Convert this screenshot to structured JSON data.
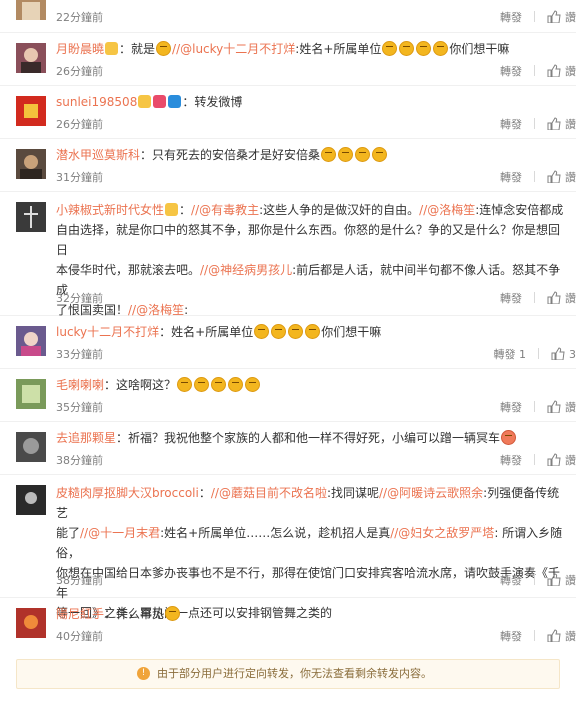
{
  "comments": [
    {
      "text": "",
      "time": "22分鐘前",
      "repost": "轉發",
      "like": "讚",
      "avatar_color": "#b28a62"
    },
    {
      "user": "月盼晨曉",
      "body_pre": "：就是",
      "mention": "//@lucky十二月不打烊",
      "body": ":姓名+所属单位",
      "body_post": "你们想干嘛",
      "time": "26分鐘前",
      "repost": "轉發",
      "like": "讚",
      "avatar_color": "#8a4f5a"
    },
    {
      "user": "sunlei198508",
      "body": "：转发微博",
      "time": "26分鐘前",
      "repost": "轉發",
      "like": "讚",
      "avatar_color": "#d22a1e"
    },
    {
      "user": "潜水甲巡莫斯科",
      "body": "：只有死去的安倍桑才是好安倍桑",
      "time": "31分鐘前",
      "repost": "轉發",
      "like": "讚",
      "avatar_color": "#5a4a3e"
    },
    {
      "user": "小辣椒式新时代女性",
      "line1_a": "：",
      "m1": "//@有毒教主",
      "line1_b": ":这些人争的是做汉奸的自由。",
      "m2": "//@洛梅笙",
      "line1_c": ":连悼念安倍都成",
      "line2": "自由选择，就是你口中的怒其不争，那你是什么东西。你怒的是什么？争的又是什么？你是想回日",
      "line3": "本侵华时代，那就滚去吧。",
      "m3": "//@神经病男孩儿",
      "line3_b": ":前后都是人话，就中间半句都不像人话。怒其不争成",
      "line4": "了恨国卖国！",
      "m4": "//@洛梅笙",
      "line4_b": ":",
      "time": "32分鐘前",
      "repost": "轉發",
      "like": "讚",
      "avatar_color": "#3a3a3a"
    },
    {
      "user": "lucky十二月不打烊",
      "body": "：姓名+所属单位",
      "body_post": "你们想干嘛",
      "time": "33分鐘前",
      "repost": "轉發 1",
      "like": "3",
      "avatar_color": "#6a5a8e"
    },
    {
      "user": "毛喇喇喇",
      "body": "：这啥啊这？",
      "time": "35分鐘前",
      "repost": "轉發",
      "like": "讚",
      "avatar_color": "#7a9a5a"
    },
    {
      "user": "去追那颗星",
      "body": "：祈福？我祝他整个家族的人都和他一样不得好死，小编可以蹭一辆冥车",
      "time": "38分鐘前",
      "repost": "轉發",
      "like": "讚",
      "avatar_color": "#4a4a4a"
    },
    {
      "user": "皮糙肉厚抠脚大汉broccoli",
      "line1_a": "：",
      "m1": "//@蘑菇目前不改名啦",
      "line1_b": ":找同谋呢",
      "m2": "//@阿暖诗云歌照余",
      "line1_c": ":列强便备传统艺",
      "line2_a": "能了",
      "m3": "//@十一月末君",
      "line2_b": ":姓名+所属单位……怎么说，趁机招人是真",
      "m4": "//@妇女之敌罗严塔",
      "line2_c": ": 所谓入乡随俗，",
      "line3": "你想在中国给日本爹办丧事也不是不行，那得在使馆门口安排宾客哈流水席，请吹鼓手演奏《千年",
      "line4": "等一回》之类，再热闹一点还可以安排钢管舞之类的",
      "time": "38分鐘前",
      "repost": "轉發",
      "like": "讚",
      "avatar_color": "#2a2a2a"
    },
    {
      "user": "陽尼紅手",
      "body": "：什么罕见",
      "time": "40分鐘前",
      "repost": "轉發",
      "like": "讚",
      "avatar_color": "#b0322a"
    }
  ],
  "notice": {
    "text": "由于部分用户进行定向转发，你无法查看剩余转发内容。",
    "icon": "info-icon"
  },
  "colors": {
    "accent": "#eb7350",
    "muted": "#808080"
  }
}
